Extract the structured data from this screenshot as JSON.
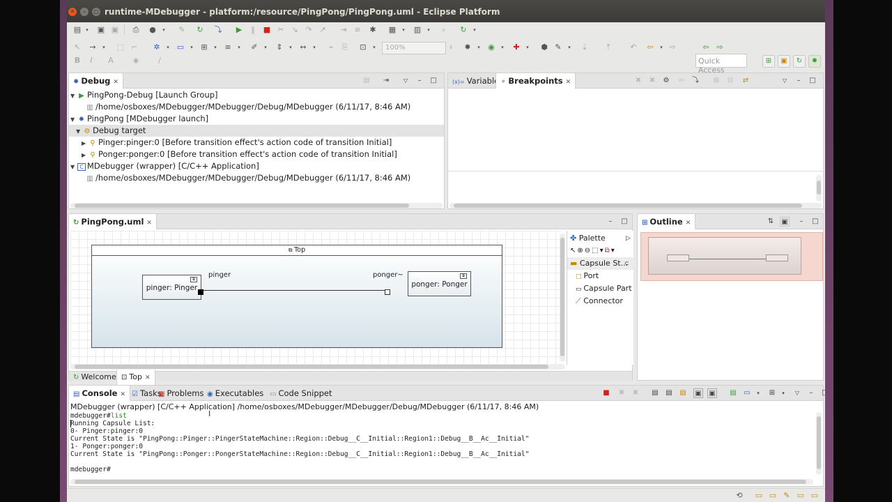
{
  "window": {
    "title": "runtime-MDebugger - platform:/resource/PingPong/PingPong.uml - Eclipse Platform"
  },
  "toolbar": {
    "zoom_value": "100%",
    "quick_access_placeholder": "Quick Access"
  },
  "debug_view": {
    "tab_label": "Debug",
    "tree": [
      {
        "label": "PingPong-Debug [Launch Group]"
      },
      {
        "label": "/home/osboxes/MDebugger/MDebugger/Debug/MDebugger (6/11/17, 8:46 AM)"
      },
      {
        "label": "PingPong [MDebugger launch]"
      },
      {
        "label": "Debug target"
      },
      {
        "label": "Pinger:pinger:0 [Before transition effect's  action code of transition Initial]"
      },
      {
        "label": "Ponger:ponger:0 [Before transition effect's  action code of transition Initial]"
      },
      {
        "label": "MDebugger (wrapper) [C/C++ Application]"
      },
      {
        "label": "/home/osboxes/MDebugger/MDebugger/Debug/MDebugger (6/11/17, 8:46 AM)"
      }
    ]
  },
  "variables_view": {
    "tab_variables": "Variables",
    "tab_breakpoints": "Breakpoints"
  },
  "editor": {
    "tab_label": "PingPong.uml",
    "diagram": {
      "capsule_title": "Top",
      "parts": [
        {
          "label": "pinger: Pinger",
          "port_label": "pinger"
        },
        {
          "label": "ponger: Ponger",
          "port_label": "ponger~"
        }
      ]
    },
    "bottom_tabs": [
      {
        "label": "Welcome"
      },
      {
        "label": "Top"
      }
    ],
    "palette": {
      "title": "Palette",
      "drawer": "Capsule St...",
      "tools": [
        {
          "label": "Port"
        },
        {
          "label": "Capsule Part"
        },
        {
          "label": "Connector"
        }
      ]
    }
  },
  "outline_view": {
    "tab_label": "Outline"
  },
  "console_view": {
    "tabs": [
      {
        "label": "Console"
      },
      {
        "label": "Tasks"
      },
      {
        "label": "Problems"
      },
      {
        "label": "Executables"
      },
      {
        "label": "Code Snippet"
      }
    ],
    "header": "MDebugger (wrapper) [C/C++ Application] /home/osboxes/MDebugger/MDebugger/Debug/MDebugger (6/11/17, 8:46 AM)",
    "prompt": "mdebugger#",
    "command": "list",
    "lines": [
      "Running Capsule List:",
      "0- Pinger:pinger:0",
      "Current State is \"PingPong::Pinger::PingerStateMachine::Region::Debug__C__Initial::Region1::Debug__B__Ac__Initial\"",
      "1- Ponger:ponger:0",
      "Current State is \"PingPong::Ponger::PongerStateMachine::Region::Debug__C__Initial::Region1::Debug__B__Ac__Initial\"",
      "",
      "mdebugger#"
    ]
  }
}
